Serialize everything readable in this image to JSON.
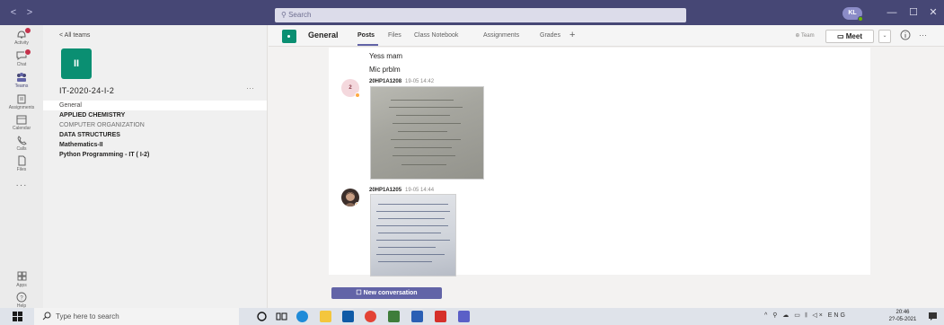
{
  "titlebar": {
    "back_label": "<",
    "forward_label": ">",
    "search_placeholder": "Search",
    "user_initials": "KL",
    "minimize_label": "—",
    "maximize_label": "☐",
    "close_label": "✕"
  },
  "rail": {
    "items": [
      {
        "label": "Activity",
        "icon": "bell-icon",
        "badge": true
      },
      {
        "label": "Chat",
        "icon": "chat-icon",
        "badge": true
      },
      {
        "label": "Teams",
        "icon": "teams-icon",
        "active": true
      },
      {
        "label": "Assignments",
        "icon": "assignments-icon"
      },
      {
        "label": "Calendar",
        "icon": "calendar-icon"
      },
      {
        "label": "Calls",
        "icon": "phone-icon"
      },
      {
        "label": "Files",
        "icon": "file-icon"
      }
    ],
    "more_label": "···",
    "apps_label": "Apps",
    "help_label": "Help"
  },
  "teams_pane": {
    "back_label": "< All teams",
    "team_tile_initials": "II",
    "team_name": "IT-2020-24-I-2",
    "more_label": "···",
    "channels": [
      {
        "label": "General",
        "style": "selected"
      },
      {
        "label": "APPLIED CHEMISTRY",
        "style": "bold"
      },
      {
        "label": "COMPUTER ORGANIZATION",
        "style": "faded"
      },
      {
        "label": "DATA STRUCTURES",
        "style": "bold"
      },
      {
        "label": "Mathematics-II",
        "style": "bold"
      },
      {
        "label": "Python Programming - IT ( I-2)",
        "style": "bold"
      }
    ]
  },
  "channel_header": {
    "name": "General",
    "tabs": [
      "Posts",
      "Files",
      "Class Notebook",
      "Assignments",
      "Grades"
    ],
    "add_tab": "+",
    "team_label": "⊕ Team",
    "meet_label": "Meet",
    "meet_caret": "⌄",
    "more_label": "···"
  },
  "conversation": {
    "messages": [
      {
        "text": "Yess mam"
      },
      {
        "text": "Mic prblm"
      }
    ],
    "posts": [
      {
        "avatar_initials": "2",
        "author": "20HP1A1208",
        "time": "19-05 14:42"
      },
      {
        "avatar_initials": "",
        "author": "20HP1A1205",
        "time": "19-05 14:44"
      }
    ],
    "new_conversation_label": "New conversation"
  },
  "taskbar": {
    "search_placeholder": "Type here to search",
    "tray_text": "ENG",
    "tray_icons": "^ ⚲ ☁ ▭ 𝄃 ◁×",
    "clock_time": "20:46",
    "clock_date": "2?-05-2021"
  },
  "colors": {
    "titlebar": "#464775",
    "accent": "#6264a7",
    "team_tile": "#0a8f72",
    "badge": "#c4314b"
  }
}
